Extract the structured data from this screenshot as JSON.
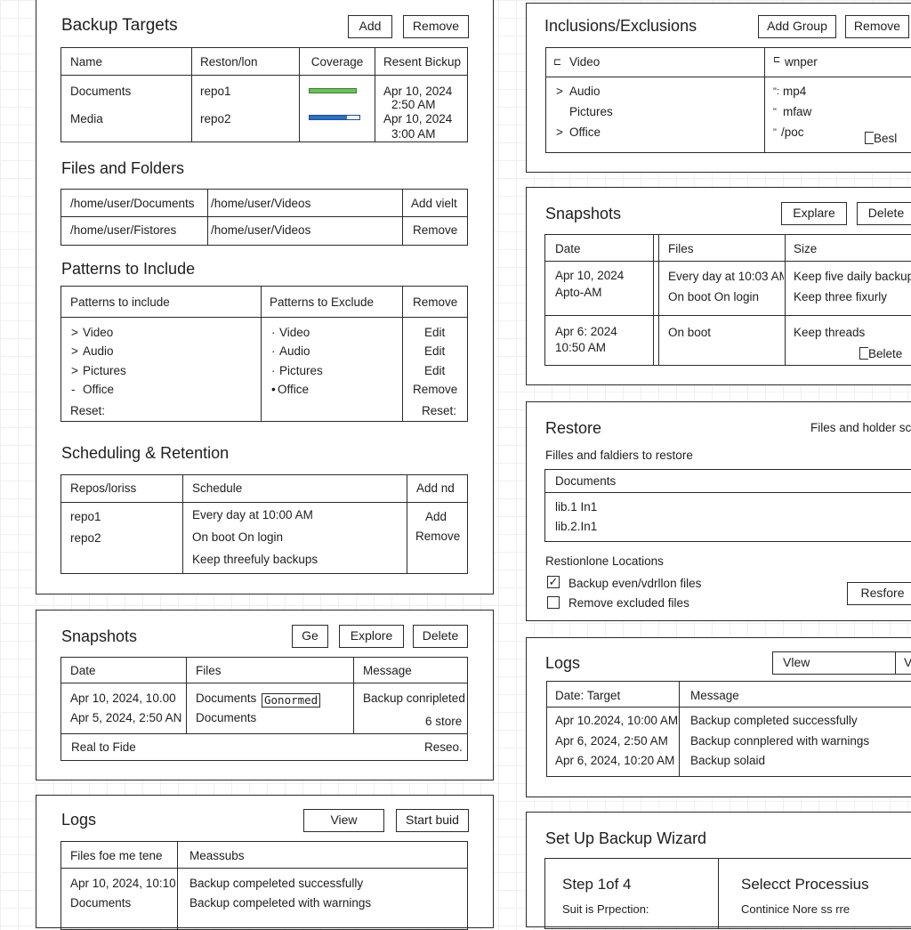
{
  "targets": {
    "title": "Backup Targets",
    "add_label": "Add",
    "remove_label": "Remove",
    "columns": [
      "Name",
      "Reston/lon",
      "Coverage",
      "Resent Bickup"
    ],
    "rows": [
      {
        "name": "Documents",
        "repo": "repo1",
        "coverage": 1.0,
        "date": "Apr 10, 2024",
        "time": "2:50 AM"
      },
      {
        "name": "Media",
        "repo": "repo2",
        "coverage": 0.75,
        "date": "Apr 10, 2024",
        "time": "3:00 AM"
      }
    ],
    "colors": {
      "bar_green": "#6fbf5a",
      "bar_blue": "#2f6fc0"
    }
  },
  "files": {
    "title": "Files and Folders",
    "rows": [
      {
        "a": "/home/user/Documents",
        "b": "/home/user/Videos",
        "action": "Add vielt"
      },
      {
        "a": "/home/user/Fistores",
        "b": "/home/user/Videos",
        "action": "Remove"
      }
    ]
  },
  "patterns": {
    "title": "Patterns to Include",
    "col_include": "Patterns to include",
    "col_exclude": "Patterns to Exclude",
    "col_action": "Remove",
    "include": [
      "Video",
      "Audio",
      "Pictures",
      "Office"
    ],
    "include_marks": [
      ">",
      ">",
      ">",
      "-"
    ],
    "exclude": [
      "Video",
      "Audio",
      "Pictures",
      "Office"
    ],
    "exclude_marks": [
      "·",
      "·",
      "·",
      "•"
    ],
    "actions": [
      "Edit",
      "Edit",
      "Edit",
      "Remove"
    ],
    "reset_left": "Reset:",
    "reset_right": "Reset:"
  },
  "scheduling": {
    "title": "Scheduling & Retention",
    "col_repos": "Repos/loriss",
    "col_schedule": "Schedule",
    "col_action": "Add nd",
    "repos": [
      "repo1",
      "repo2"
    ],
    "schedule": [
      "Every day at 10:00 AM",
      "On boot  On login",
      "Keep threefuly backups"
    ],
    "add_label": "Add",
    "remove_label": "Remove"
  },
  "snapshots_left": {
    "title": "Snapshots",
    "btn_ge": "Ge",
    "btn_explore": "Explore",
    "btn_delete": "Delete",
    "columns": [
      "Date",
      "Files",
      "Message"
    ],
    "dates": [
      "Apr 10, 2024, 10.00",
      "Apr 5, 2024, 2:50 AN"
    ],
    "files": [
      "Documents",
      "Documents"
    ],
    "tag": "Gonormed",
    "messages": [
      "Backup conripleted",
      "6 store"
    ],
    "footer_left": "Real to Fide",
    "footer_right": "Reseo."
  },
  "logs_left": {
    "title": "Logs",
    "view_label": "View",
    "start_label": "Start buid",
    "columns": [
      "Files foe me tene",
      "Meassubs"
    ],
    "rows": [
      {
        "a": "Apr 10, 2024, 10:10",
        "b": "Backup compeleted successfully"
      },
      {
        "a": "Documents",
        "b": "Backup compeleted with warnings"
      }
    ]
  },
  "inclusions": {
    "title": "Inclusions/Exclusions",
    "add_group_label": "Add Group",
    "remove_label": "Remove",
    "left_head": "Video",
    "left_head_icon": "folder-icon",
    "left_items": [
      {
        "mark": ">",
        "label": "Audio"
      },
      {
        "mark": "",
        "label": "Pictures"
      },
      {
        "mark": ">",
        "label": "Office"
      }
    ],
    "right_head": "wnper",
    "right_items": [
      "mp4",
      "mfaw",
      "/poc"
    ],
    "right_marks": [
      "\":",
      "\"",
      "\""
    ],
    "best_label": "Besl"
  },
  "snapshots_right": {
    "title": "Snapshots",
    "explore_label": "Explare",
    "delete_label": "Delete",
    "columns": [
      "Date",
      "Files",
      "Size"
    ],
    "row1": {
      "date": "Apr 10, 2024",
      "date2": "Apto-AM",
      "files": [
        "Every day at 10:03 AM",
        "On boot  On login"
      ],
      "size": [
        "Keep five daily backups",
        "Keep three fixurly"
      ]
    },
    "row2": {
      "date": "Apr 6: 2024",
      "date2": "10:50 AM",
      "files": "On boot",
      "size": "Keep threads",
      "delete": "Belete"
    }
  },
  "restore": {
    "title": "Restore",
    "right_hint": "Files and holder sc",
    "subtitle": "Filles and faldiers to restore",
    "list_head": "Documents",
    "items": [
      "lib.1 In1",
      "lib.2.In1"
    ],
    "locations_label": "Restionlone Locations",
    "opt1": "Backup even/vdrllon files",
    "opt1_checked": true,
    "opt2": "Remove excluded files",
    "opt2_checked": false,
    "restore_label": "Resfore"
  },
  "logs_right": {
    "title": "Logs",
    "view_label": "Vlew",
    "extra_label": "V",
    "columns": [
      "Date: Target",
      "Message"
    ],
    "rows": [
      {
        "a": "Apr 10.2024, 10:00 AM",
        "b": "Backup completed successfully"
      },
      {
        "a": "Apr 6, 2024, 2:50 AM",
        "b": "Backup connplered with warnings"
      },
      {
        "a": "Apr 6, 2024, 10:20 AM",
        "b": "Backup solaid"
      }
    ]
  },
  "wizard": {
    "title": "Set Up Backup Wizard",
    "step": "Step 1of 4",
    "step_sub": "Suit is Prpection:",
    "select": "Selecct Processius",
    "select_sub": "Continice Nore ss rre"
  }
}
